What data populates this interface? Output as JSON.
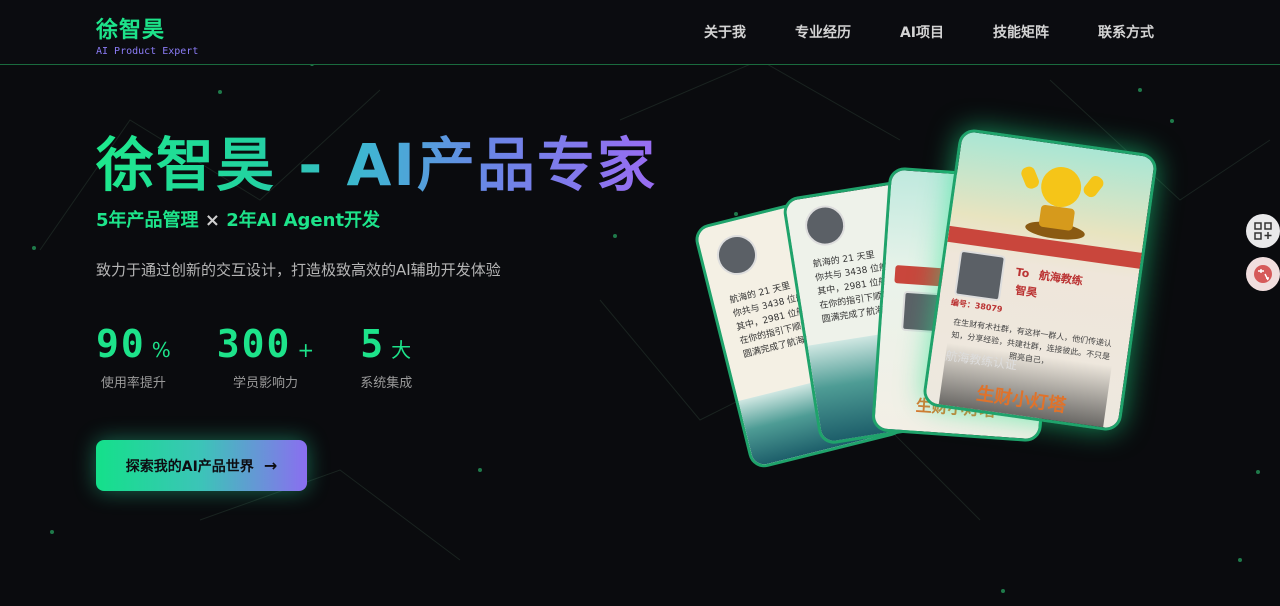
{
  "header": {
    "brand_name": "徐智昊",
    "brand_sub": "AI Product Expert",
    "nav": [
      "关于我",
      "专业经历",
      "AI项目",
      "技能矩阵",
      "联系方式"
    ]
  },
  "hero": {
    "title": "徐智昊 - AI产品专家",
    "sub_left": "5年产品管理",
    "sub_x": "×",
    "sub_right": "2年AI Agent开发",
    "desc": "致力于通过创新的交互设计，打造极致高效的AI辅助开发体验",
    "stats": [
      {
        "num": "90",
        "unit": "%",
        "label": "使用率提升"
      },
      {
        "num": "300",
        "unit": "+",
        "label": "学员影响力"
      },
      {
        "num": "5",
        "unit": "大",
        "label": "系统集成"
      }
    ],
    "cta_label": "探索我的AI产品世界",
    "cta_arrow": "→"
  },
  "cards": {
    "to_label": "To",
    "name": "航海教练",
    "person": "智昊",
    "id_label": "编号：38079",
    "lighthouse": "生财小灯塔",
    "cert": "航海教练认证",
    "text1": "航海的 21 天里",
    "text2": "你共与 3438 位船员",
    "text3": "其中，2981 位船员",
    "text4": "在你的指引下顺利",
    "text5": "圆满完成了航海之",
    "card_body": "在生财有术社群，有这样一群人，他们传递认知，分享经验，共建社群，连接彼此。不只是照亮自己，",
    "card_body2": "也照亮他人……"
  },
  "side": {
    "btn1_icon": "qr-grid-icon",
    "btn2_icon": "translate-icon"
  },
  "colors": {
    "accent": "#1de38a",
    "purple": "#8b7cf6",
    "bg": "#0a0b0e"
  }
}
